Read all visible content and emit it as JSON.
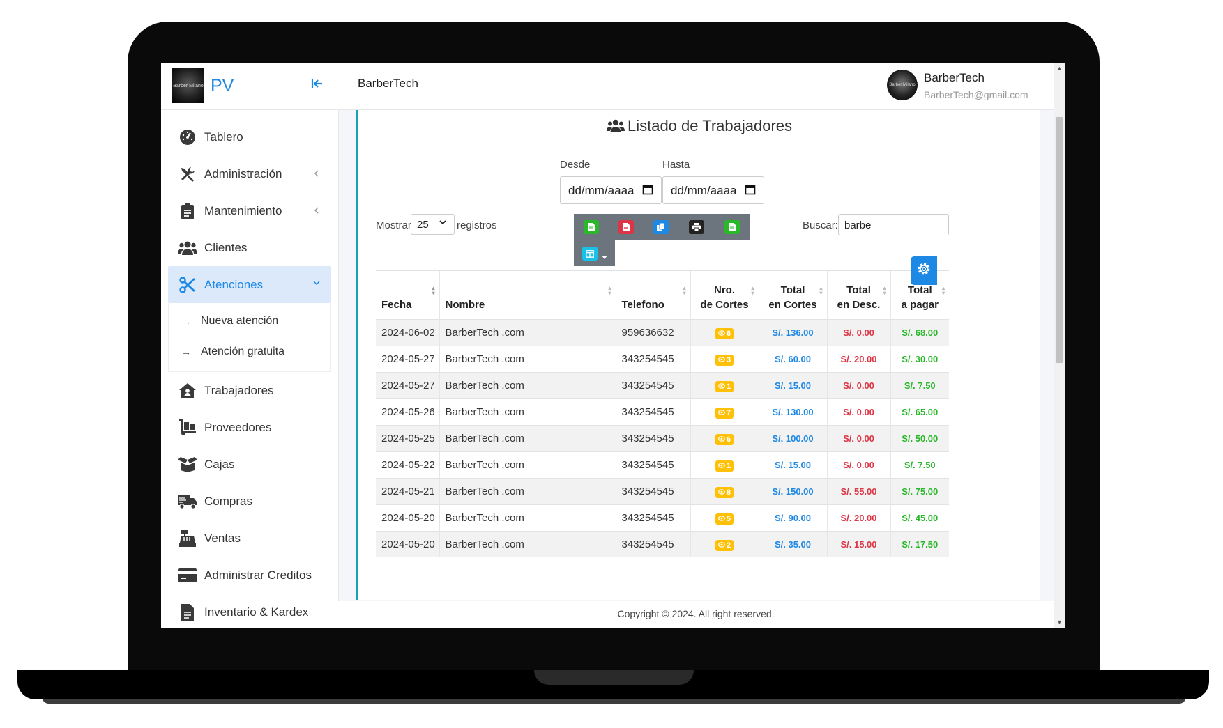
{
  "sidebar": {
    "brand": "PV",
    "logo_text": "Barber Milano",
    "items": [
      {
        "label": "Tablero",
        "icon": "dashboard-gauge-icon",
        "has_chevron": false
      },
      {
        "label": "Administración",
        "icon": "tools-icon",
        "has_chevron": true
      },
      {
        "label": "Mantenimiento",
        "icon": "clipboard-icon",
        "has_chevron": true
      },
      {
        "label": "Clientes",
        "icon": "users-icon",
        "has_chevron": false
      },
      {
        "label": "Atenciones",
        "icon": "scissors-icon",
        "has_chevron": true,
        "active": true
      },
      {
        "label": "Trabajadores",
        "icon": "house-user-icon",
        "has_chevron": false
      },
      {
        "label": "Proveedores",
        "icon": "dolly-icon",
        "has_chevron": false
      },
      {
        "label": "Cajas",
        "icon": "box-open-icon",
        "has_chevron": false
      },
      {
        "label": "Compras",
        "icon": "truck-icon",
        "has_chevron": false
      },
      {
        "label": "Ventas",
        "icon": "cash-register-icon",
        "has_chevron": false
      },
      {
        "label": "Administrar Creditos",
        "icon": "credit-card-icon",
        "has_chevron": false
      },
      {
        "label": "Inventario & Kardex",
        "icon": "file-icon",
        "has_chevron": false
      }
    ],
    "submenu": [
      {
        "label": "Nueva atención"
      },
      {
        "label": "Atención gratuita"
      }
    ]
  },
  "header": {
    "title": "BarberTech",
    "user_name": "BarberTech",
    "user_email": "BarberTech@gmail.com"
  },
  "main": {
    "title": "Listado de Trabajadores",
    "filters": {
      "desde_label": "Desde",
      "hasta_label": "Hasta",
      "desde_value": "dd/mm/aaaa",
      "hasta_value": "dd/mm/aaaa"
    },
    "length": {
      "prefix": "Mostrar",
      "value": "25",
      "suffix": "registros"
    },
    "search": {
      "label": "Buscar:",
      "value": "barbe"
    },
    "export_buttons": [
      {
        "name": "csv",
        "color": "#28b828"
      },
      {
        "name": "pdf",
        "color": "#dc3545"
      },
      {
        "name": "copy",
        "color": "#1e88e5"
      },
      {
        "name": "print",
        "color": "#222222"
      },
      {
        "name": "excel",
        "color": "#28b828"
      }
    ],
    "columns_button_color": "#17c1e8",
    "table": {
      "headers": [
        {
          "l1": "",
          "l2": "Fecha"
        },
        {
          "l1": "",
          "l2": "Nombre"
        },
        {
          "l1": "",
          "l2": "Telefono"
        },
        {
          "l1": "Nro.",
          "l2": "de Cortes"
        },
        {
          "l1": "Total",
          "l2": "en Cortes"
        },
        {
          "l1": "Total",
          "l2": "en Desc."
        },
        {
          "l1": "Total",
          "l2": "a pagar"
        }
      ],
      "rows": [
        {
          "fecha": "2024-06-02",
          "nombre": "BarberTech .com",
          "telefono": "959636632",
          "cortes": "6",
          "total_cortes": "S/. 136.00",
          "total_desc": "S/. 0.00",
          "total_pagar": "S/. 68.00"
        },
        {
          "fecha": "2024-05-27",
          "nombre": "BarberTech .com",
          "telefono": "343254545",
          "cortes": "3",
          "total_cortes": "S/. 60.00",
          "total_desc": "S/. 20.00",
          "total_pagar": "S/. 30.00"
        },
        {
          "fecha": "2024-05-27",
          "nombre": "BarberTech .com",
          "telefono": "343254545",
          "cortes": "1",
          "total_cortes": "S/. 15.00",
          "total_desc": "S/. 0.00",
          "total_pagar": "S/. 7.50"
        },
        {
          "fecha": "2024-05-26",
          "nombre": "BarberTech .com",
          "telefono": "343254545",
          "cortes": "7",
          "total_cortes": "S/. 130.00",
          "total_desc": "S/. 0.00",
          "total_pagar": "S/. 65.00"
        },
        {
          "fecha": "2024-05-25",
          "nombre": "BarberTech .com",
          "telefono": "343254545",
          "cortes": "6",
          "total_cortes": "S/. 100.00",
          "total_desc": "S/. 0.00",
          "total_pagar": "S/. 50.00"
        },
        {
          "fecha": "2024-05-22",
          "nombre": "BarberTech .com",
          "telefono": "343254545",
          "cortes": "1",
          "total_cortes": "S/. 15.00",
          "total_desc": "S/. 0.00",
          "total_pagar": "S/. 7.50"
        },
        {
          "fecha": "2024-05-21",
          "nombre": "BarberTech .com",
          "telefono": "343254545",
          "cortes": "8",
          "total_cortes": "S/. 150.00",
          "total_desc": "S/. 55.00",
          "total_pagar": "S/. 75.00"
        },
        {
          "fecha": "2024-05-20",
          "nombre": "BarberTech .com",
          "telefono": "343254545",
          "cortes": "5",
          "total_cortes": "S/. 90.00",
          "total_desc": "S/. 20.00",
          "total_pagar": "S/. 45.00"
        },
        {
          "fecha": "2024-05-20",
          "nombre": "BarberTech .com",
          "telefono": "343254545",
          "cortes": "2",
          "total_cortes": "S/. 35.00",
          "total_desc": "S/. 15.00",
          "total_pagar": "S/. 17.50"
        }
      ]
    }
  },
  "footer": {
    "text": "Copyright © 2024. All right reserved."
  },
  "colors": {
    "accent": "#1e88e5",
    "card_border": "#17a2b8",
    "badge": "#ffc107",
    "money_blue": "#1e88e5",
    "money_red": "#dc3545",
    "money_green": "#28b828"
  }
}
